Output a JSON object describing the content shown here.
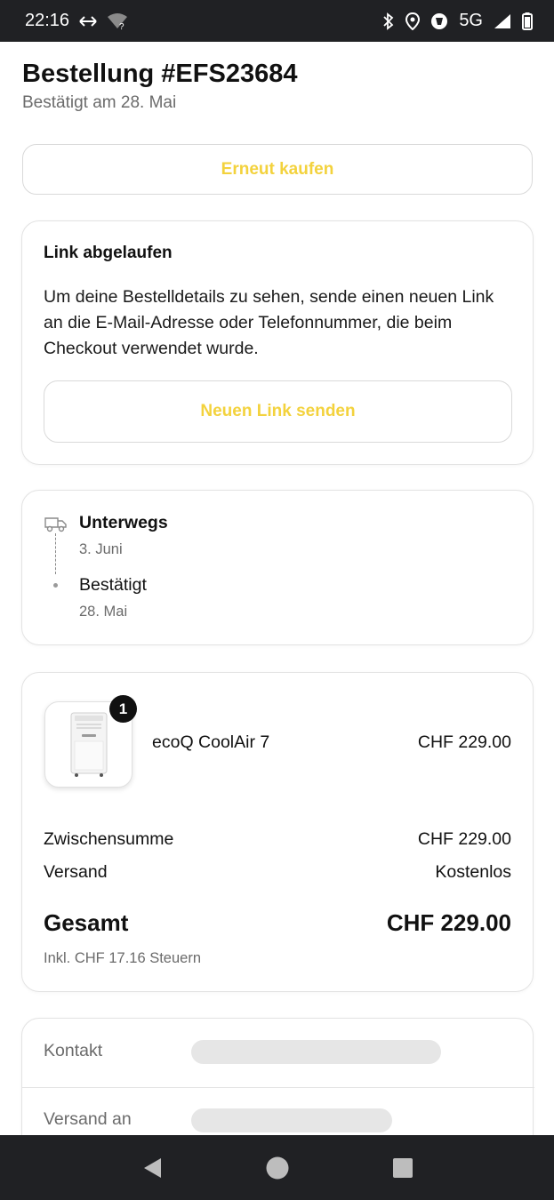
{
  "status_bar": {
    "time": "22:16",
    "network": "5G",
    "icons": [
      "data-transfer-icon",
      "wifi-question-icon",
      "bluetooth-icon",
      "location-icon",
      "vpn-icon",
      "signal-icon",
      "battery-icon"
    ]
  },
  "header": {
    "title": "Bestellung #EFS23684",
    "subtitle": "Bestätigt am 28. Mai"
  },
  "actions": {
    "rebuy_label": "Erneut kaufen"
  },
  "link_card": {
    "heading": "Link abgelaufen",
    "body": "Um deine Bestelldetails zu sehen, sende einen neuen Link an die E-Mail-Adresse oder Telefonnummer, die beim Checkout verwendet wurde.",
    "button_label": "Neuen Link senden"
  },
  "tracking": {
    "steps": [
      {
        "title": "Unterwegs",
        "date": "3. Juni"
      },
      {
        "title": "Bestätigt",
        "date": "28. Mai"
      }
    ]
  },
  "order": {
    "item": {
      "quantity": "1",
      "name": "ecoQ CoolAir 7",
      "price": "CHF 229.00"
    },
    "subtotal_label": "Zwischensumme",
    "subtotal_value": "CHF 229.00",
    "shipping_label": "Versand",
    "shipping_value": "Kostenlos",
    "total_label": "Gesamt",
    "total_value": "CHF 229.00",
    "tax_note": "Inkl. CHF 17.16 Steuern"
  },
  "contact": {
    "contact_label": "Kontakt",
    "ship_to_label": "Versand an"
  },
  "colors": {
    "accent": "#f3d23d",
    "system_bar": "#202124",
    "muted_text": "#6b6b6b",
    "border": "#e3e3e3"
  }
}
